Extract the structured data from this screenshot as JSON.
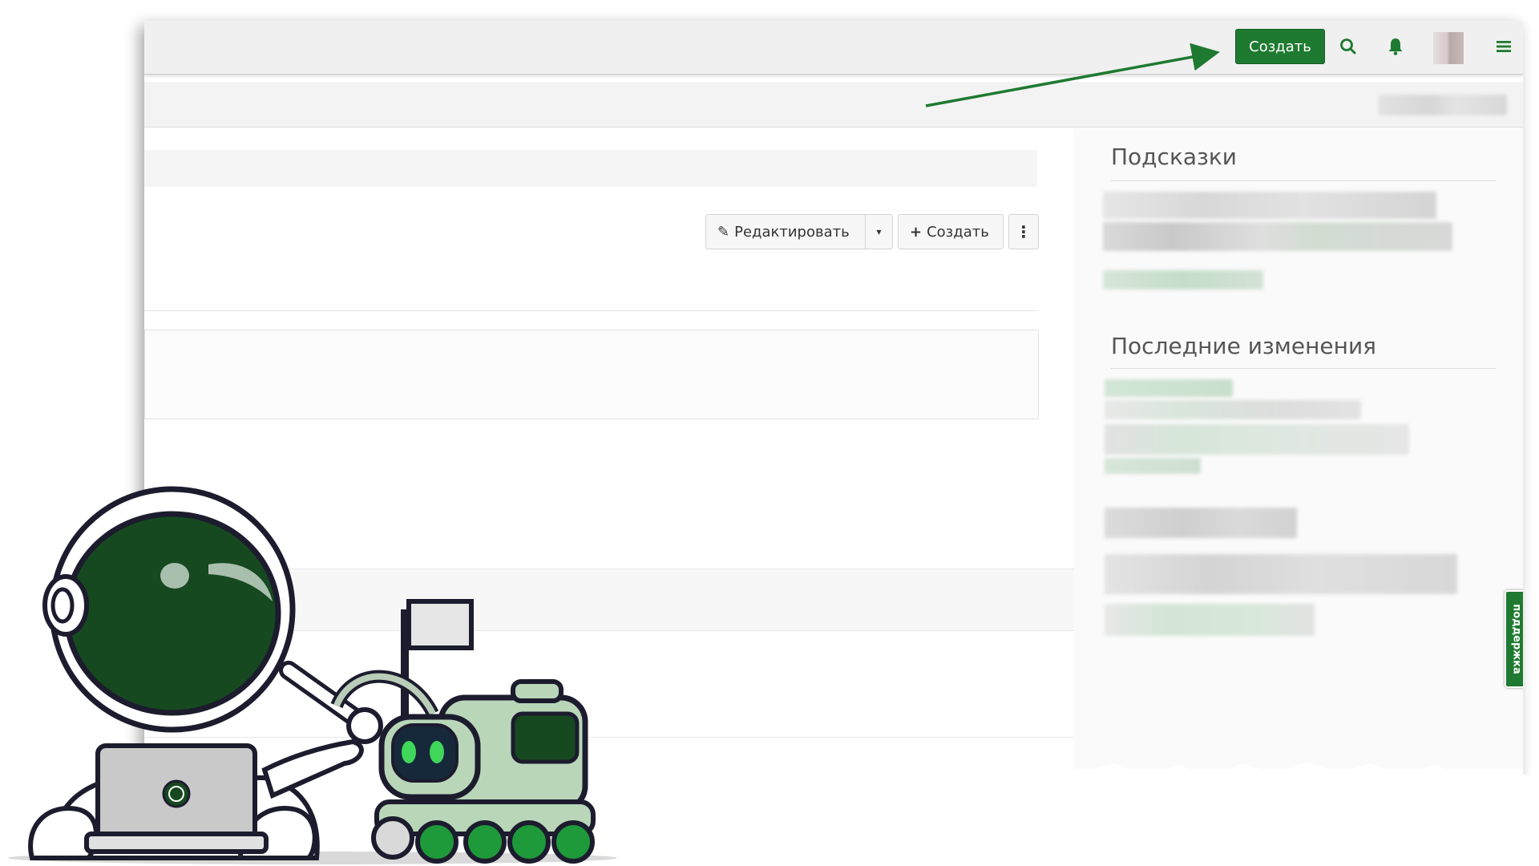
{
  "topbar": {
    "create_label": "Создать",
    "icons": [
      "search-icon",
      "bell-icon",
      "avatar",
      "menu-icon"
    ],
    "accent": "#1e7a30"
  },
  "toolbar": {
    "edit_label": "Редактировать",
    "create_label": "Создать"
  },
  "sidebar": {
    "hints_title": "Подсказки",
    "recent_title": "Последние изменения",
    "support_label": "поддержка"
  }
}
